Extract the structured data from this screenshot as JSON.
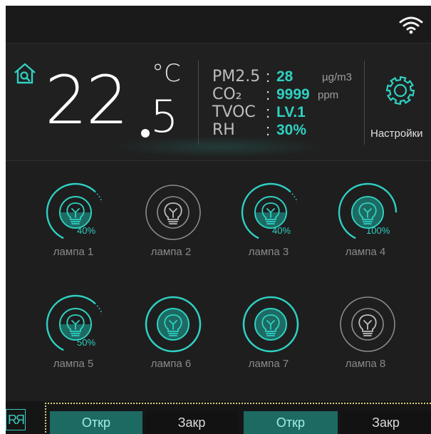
{
  "status": {
    "wifi_icon": "wifi-icon"
  },
  "climate": {
    "temp_whole": "22",
    "temp_fraction": "5",
    "temp_unit": "°C",
    "sensors": [
      {
        "label": "PM2.5",
        "value": "28",
        "unit": "µg/m3"
      },
      {
        "label": "CO₂",
        "value": "9999",
        "unit": "ppm"
      },
      {
        "label": "TVOC",
        "value": "LV.1",
        "unit": ""
      },
      {
        "label": "RH",
        "value": "30%",
        "unit": ""
      }
    ]
  },
  "settings": {
    "label": "Настройки"
  },
  "lamps": [
    {
      "name": "лампа 1",
      "percent": "40%",
      "state": "dim",
      "level": 0.4
    },
    {
      "name": "лампа 2",
      "percent": "",
      "state": "off",
      "level": 0
    },
    {
      "name": "лампа 3",
      "percent": "40%",
      "state": "dim",
      "level": 0.4
    },
    {
      "name": "лампа 4",
      "percent": "100%",
      "state": "full",
      "level": 1.0
    },
    {
      "name": "лампа 5",
      "percent": "50%",
      "state": "dim",
      "level": 0.5
    },
    {
      "name": "лампа 6",
      "percent": "",
      "state": "on",
      "level": 1.0
    },
    {
      "name": "лампа 7",
      "percent": "",
      "state": "on",
      "level": 1.0
    },
    {
      "name": "лампа 8",
      "percent": "",
      "state": "off",
      "level": 0
    }
  ],
  "bottom": {
    "logo": "RЯ",
    "buttons": [
      {
        "label": "Откр",
        "active": true
      },
      {
        "label": "Закр",
        "active": false
      },
      {
        "label": "Откр",
        "active": true
      },
      {
        "label": "Закр",
        "active": false
      }
    ]
  },
  "colors": {
    "accent": "#2fd0c2",
    "accent_dark": "#1d6a63",
    "background": "#1e1e1e",
    "muted": "#8a8a8a"
  }
}
